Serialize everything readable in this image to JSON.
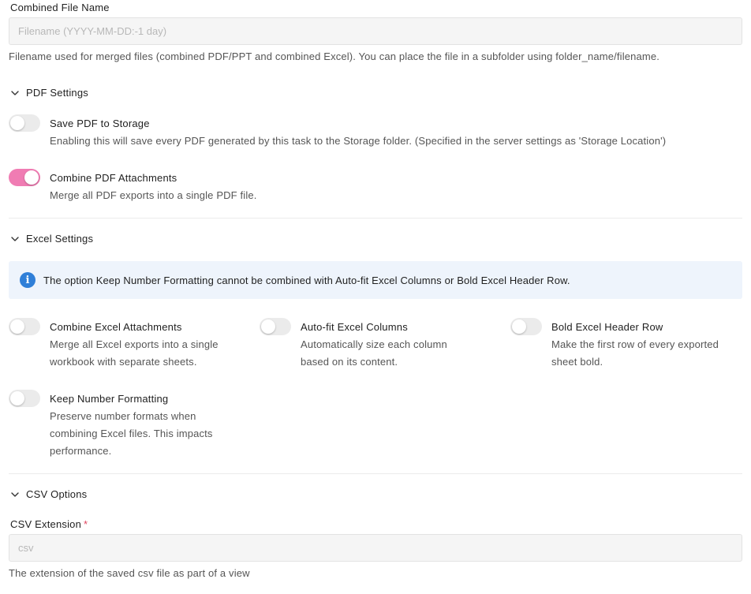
{
  "combined_file": {
    "label": "Combined File Name",
    "placeholder": "Filename (YYYY-MM-DD:-1 day)",
    "value": "",
    "help": "Filename used for merged files (combined PDF/PPT and combined Excel). You can place the file in a subfolder using folder_name/filename."
  },
  "pdf_settings": {
    "title": "PDF Settings",
    "save_pdf": {
      "title": "Save PDF to Storage",
      "desc": "Enabling this will save every PDF generated by this task to the Storage folder. (Specified in the server settings as 'Storage Location')",
      "enabled": false
    },
    "combine_pdf": {
      "title": "Combine PDF Attachments",
      "desc": "Merge all PDF exports into a single PDF file.",
      "enabled": true
    }
  },
  "excel_settings": {
    "title": "Excel Settings",
    "info": "The option Keep Number Formatting cannot be combined with Auto-fit Excel Columns or Bold Excel Header Row.",
    "combine_excel": {
      "title": "Combine Excel Attachments",
      "desc_line1": "Merge all Excel exports into a single",
      "desc_line2": "workbook with separate sheets.",
      "enabled": false
    },
    "autofit": {
      "title": "Auto-fit Excel Columns",
      "desc_line1": "Automatically size each column",
      "desc_line2": "based on its content.",
      "enabled": false
    },
    "bold_header": {
      "title": "Bold Excel Header Row",
      "desc_line1": "Make the first row of every exported",
      "desc_line2": "sheet bold.",
      "enabled": false
    },
    "keep_number": {
      "title": "Keep Number Formatting",
      "desc_line1": "Preserve number formats when",
      "desc_line2": "combining Excel files. This impacts",
      "desc_line3": "performance.",
      "enabled": false
    }
  },
  "csv_options": {
    "title": "CSV Options",
    "extension_label": "CSV Extension",
    "required_mark": "*",
    "extension_placeholder": "csv",
    "extension_value": "",
    "help": "The extension of the saved csv file as part of a view"
  },
  "colors": {
    "accent_toggle_on": "#f07cb3",
    "info_icon": "#2f7fd8",
    "info_bg": "#eef4fc",
    "required": "#e0455f"
  },
  "icons": {
    "section_chevron": "chevron-down-icon",
    "info": "info-icon"
  }
}
